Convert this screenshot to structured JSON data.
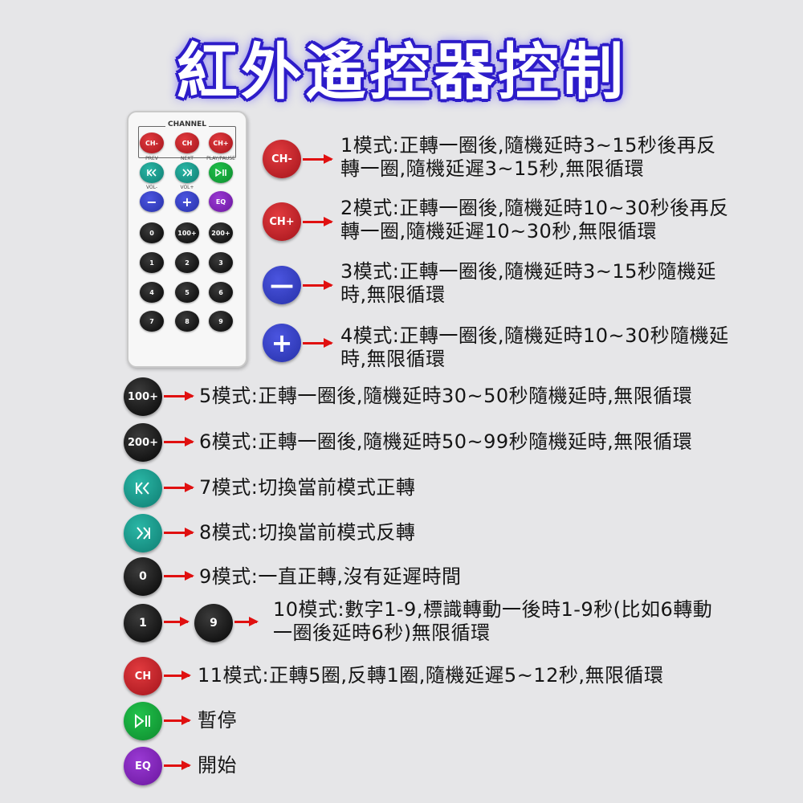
{
  "title": "紅外遙控器控制",
  "remote": {
    "channel_label": "CHANNEL",
    "top_row": [
      "CH-",
      "CH",
      "CH+"
    ],
    "sub_labels_1": [
      "PREV",
      "NEXT",
      "PLAY/PAUSE"
    ],
    "sub_labels_2": [
      "VOL-",
      "VOL+",
      ""
    ],
    "row_eq": "EQ",
    "row_0": [
      "0",
      "100+",
      "200+"
    ],
    "row_1": [
      "1",
      "2",
      "3"
    ],
    "row_2": [
      "4",
      "5",
      "6"
    ],
    "row_3": [
      "7",
      "8",
      "9"
    ]
  },
  "modes": [
    {
      "button": "CH-",
      "icon": "ch-minus-button",
      "text": "1模式:正轉一圈後,隨機延時3~15秒後再反\n轉一圈,隨機延遲3~15秒,無限循環"
    },
    {
      "button": "CH+",
      "icon": "ch-plus-button",
      "text": "2模式:正轉一圈後,隨機延時10~30秒後再反\n轉一圈,隨機延遲10~30秒,無限循環"
    },
    {
      "button": "—",
      "icon": "minus-button",
      "text": "3模式:正轉一圈後,隨機延時3~15秒隨機延\n時,無限循環"
    },
    {
      "button": "+",
      "icon": "plus-button",
      "text": "4模式:正轉一圈後,隨機延時10~30秒隨機延\n時,無限循環"
    },
    {
      "button": "100+",
      "icon": "100-plus-button",
      "text": "5模式:正轉一圈後,隨機延時30~50秒隨機延時,無限循環"
    },
    {
      "button": "200+",
      "icon": "200-plus-button",
      "text": "6模式:正轉一圈後,隨機延時50~99秒隨機延時,無限循環"
    },
    {
      "button": "",
      "icon": "prev-icon",
      "text": "7模式:切換當前模式正轉"
    },
    {
      "button": "",
      "icon": "next-icon",
      "text": "8模式:切換當前模式反轉"
    },
    {
      "button": "0",
      "icon": "zero-button",
      "text": "9模式:一直正轉,沒有延遲時間"
    },
    {
      "button": "1",
      "button_end": "9",
      "icon": "number-button",
      "text": "10模式:數字1-9,標識轉動一後時1-9秒(比如6轉動\n一圈後延時6秒)無限循環"
    },
    {
      "button": "CH",
      "icon": "ch-button",
      "text": "11模式:正轉5圈,反轉1圈,隨機延遲5~12秒,無限循環"
    },
    {
      "button": "",
      "icon": "play-pause-icon",
      "text": "暫停"
    },
    {
      "button": "EQ",
      "icon": "eq-button",
      "text": "開始"
    }
  ]
}
